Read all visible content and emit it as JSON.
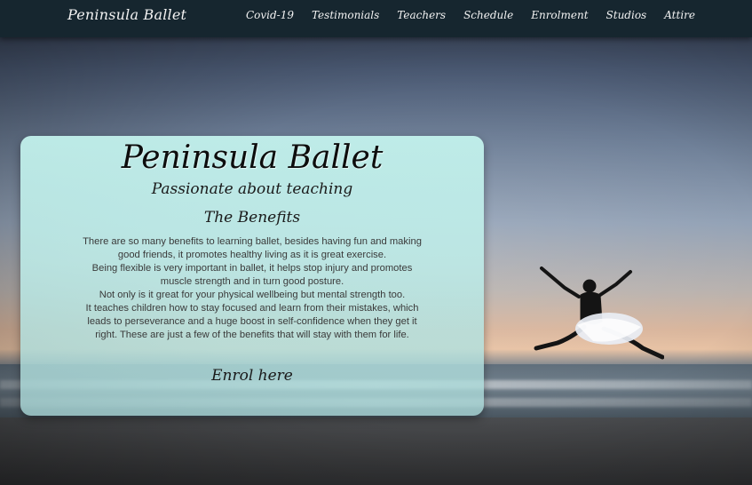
{
  "nav": {
    "brand": "Peninsula Ballet",
    "links": [
      "Covid-19",
      "Testimonials",
      "Teachers",
      "Schedule",
      "Enrolment",
      "Studios",
      "Attire"
    ]
  },
  "hero": {
    "title": "Peninsula Ballet",
    "subtitle": "Passionate about teaching",
    "heading": "The Benefits",
    "paragraphs": [
      "There are so many benefits to learning ballet, besides having fun and making good friends, it promotes healthy living as it is great exercise.",
      "Being flexible is very important in ballet, it helps stop injury and promotes muscle strength and in turn good posture.",
      "Not only is it great for your physical wellbeing but mental strength too.",
      "It teaches children how to stay focused and learn from their mistakes, which leads to perseverance and a huge boost in self-confidence when they get it right. These are just a few of the benefits that will stay with them for life."
    ],
    "cta": "Enrol here"
  },
  "colors": {
    "navbar": "#16262f",
    "panel": "#c4f4ee"
  }
}
